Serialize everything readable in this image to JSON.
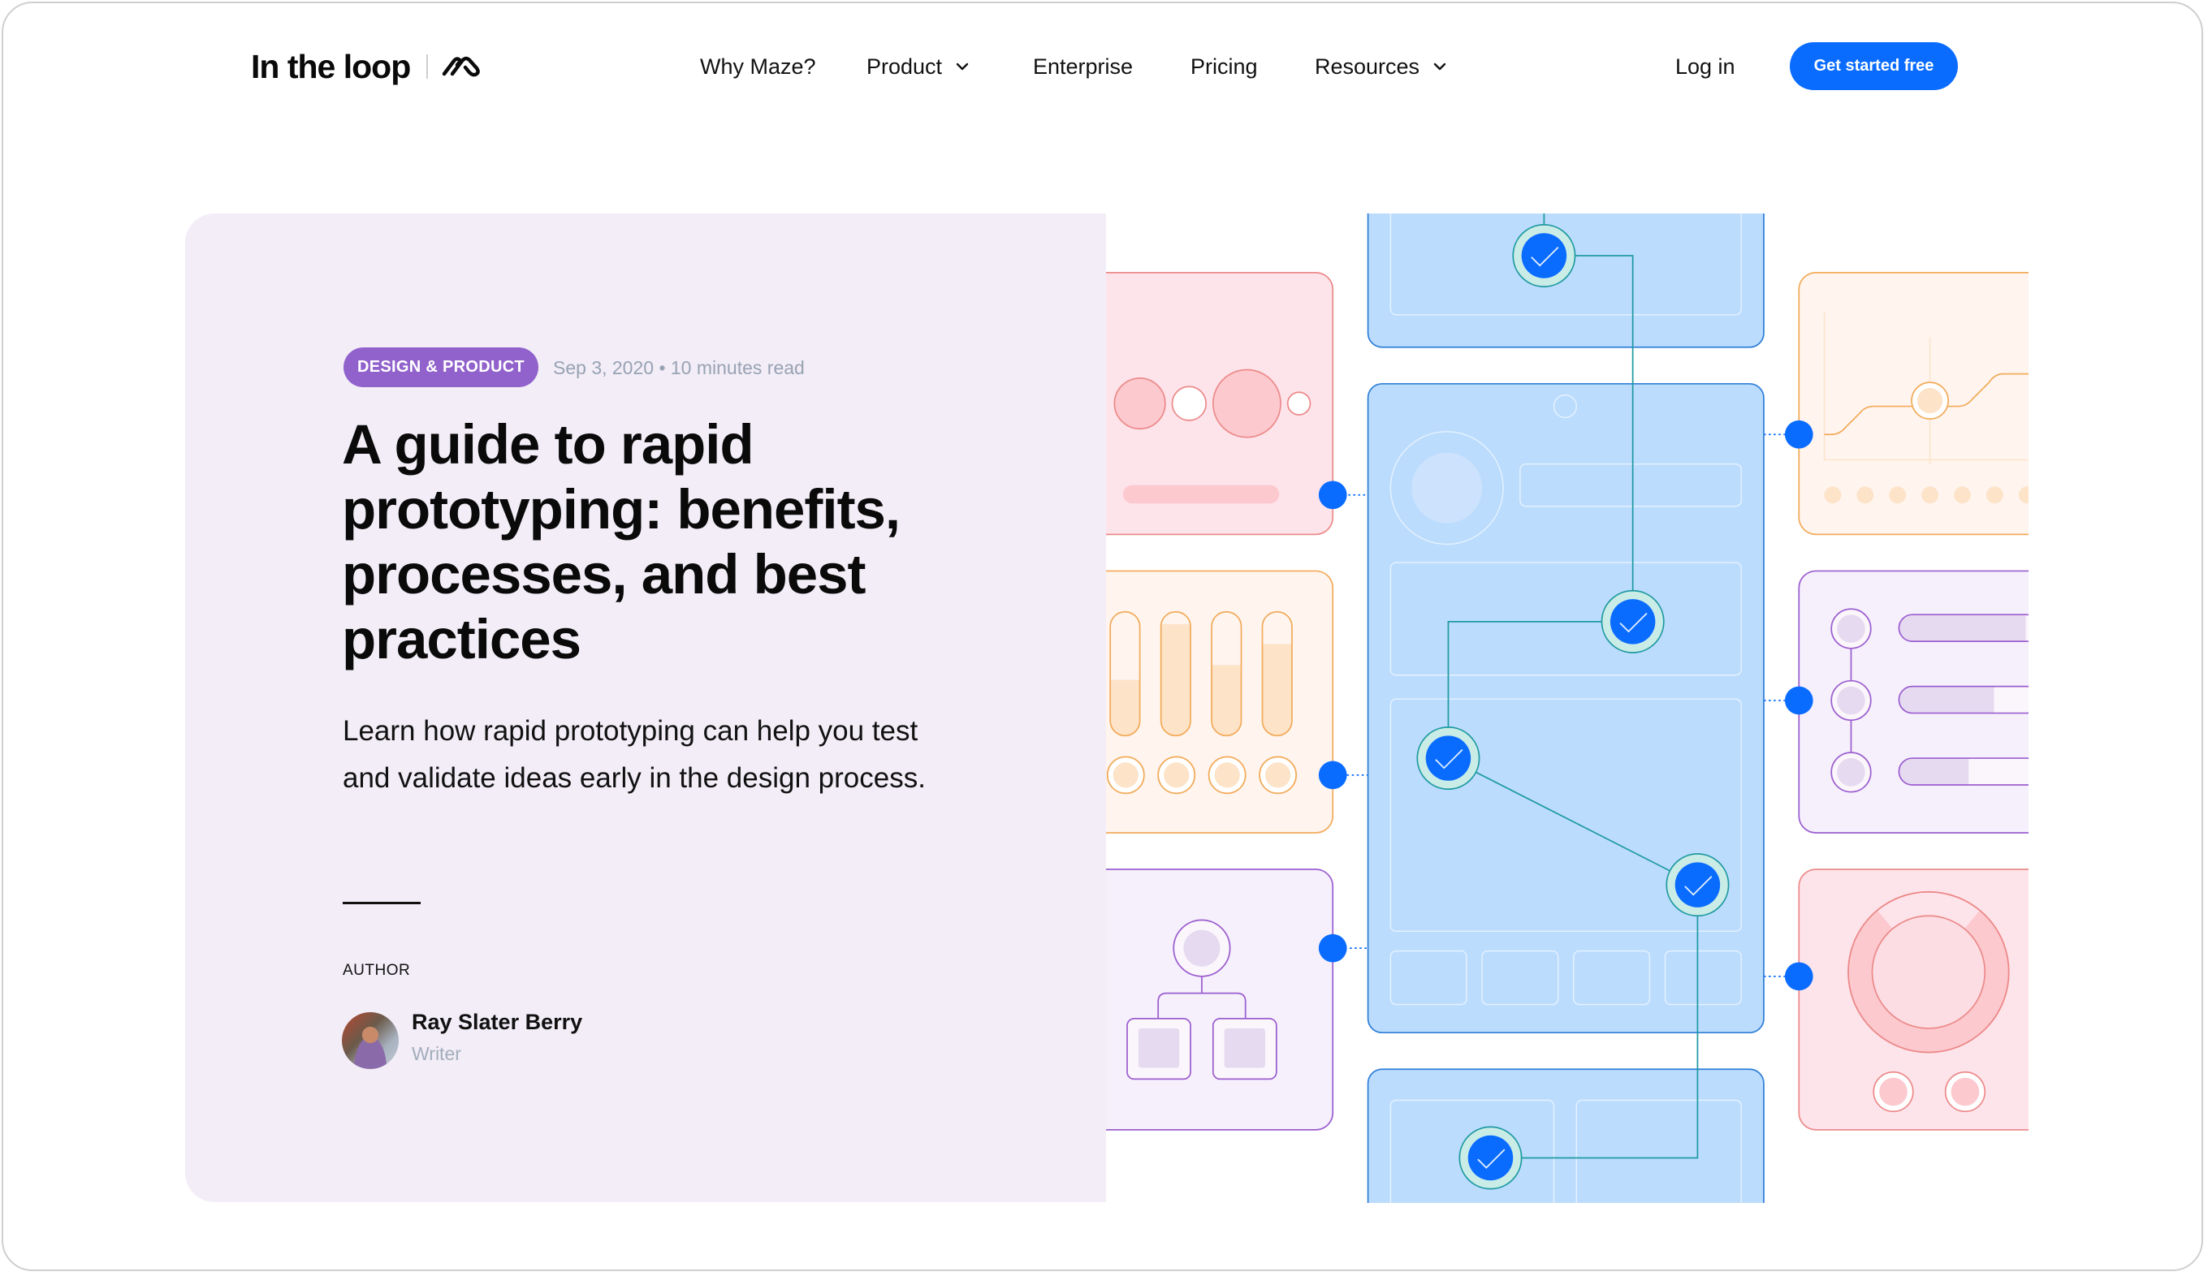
{
  "header": {
    "logo_text": "In the loop",
    "brand_icon": "maze-logo-icon",
    "nav": [
      {
        "label": "Why Maze?",
        "has_dropdown": false
      },
      {
        "label": "Product",
        "has_dropdown": true
      },
      {
        "label": "Enterprise",
        "has_dropdown": false
      },
      {
        "label": "Pricing",
        "has_dropdown": false
      },
      {
        "label": "Resources",
        "has_dropdown": true
      }
    ],
    "login_label": "Log in",
    "cta_label": "Get started free"
  },
  "article": {
    "category": "DESIGN & PRODUCT",
    "meta": "Sep 3, 2020 • 10 minutes read",
    "title": "A guide to rapid prototyping: benefits, processes, and best practices",
    "description": "Learn how rapid prototyping can help you test and validate ideas early in the design process.",
    "author_label": "AUTHOR",
    "author_name": "Ray Slater Berry",
    "author_role": "Writer"
  },
  "illustration": {
    "progress_bars_fill": [
      0.45,
      0.9,
      0.57,
      0.74
    ],
    "list_bars_fill": [
      1.0,
      0.75,
      0.55
    ],
    "donut_fill": 0.78,
    "checkpoints": 5
  },
  "colors": {
    "accent_blue": "#0a6cff",
    "badge_purple": "#9161cc",
    "card_bg": "#f2edf7",
    "meta_gray": "#98a2b3"
  }
}
